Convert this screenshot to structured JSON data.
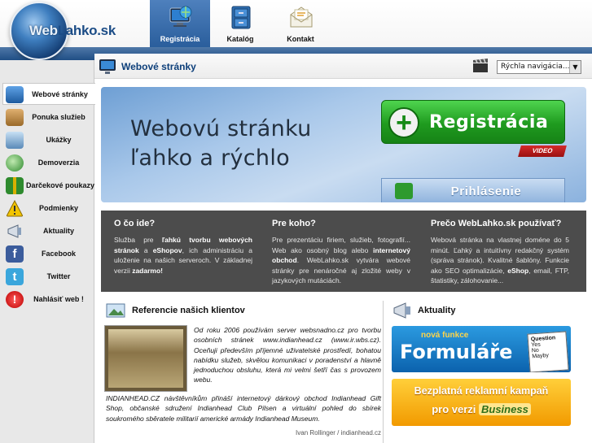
{
  "logo": {
    "part1": "Web",
    "part2": "Lahko.sk"
  },
  "nav": {
    "tabs": [
      {
        "label": "Registrácia",
        "icon": "monitor-globe-icon",
        "active": true
      },
      {
        "label": "Katalóg",
        "icon": "cabinet-icon",
        "active": false
      },
      {
        "label": "Kontakt",
        "icon": "envelope-icon",
        "active": false
      }
    ]
  },
  "sidebar": {
    "items": [
      {
        "label": "Webové stránky",
        "icon": "monitor-icon",
        "active": true
      },
      {
        "label": "Ponuka služieb",
        "icon": "box-icon"
      },
      {
        "label": "Ukážky",
        "icon": "image-icon"
      },
      {
        "label": "Demoverzia",
        "icon": "magnifier-icon"
      },
      {
        "label": "Darčekové poukazy",
        "icon": "gift-icon"
      },
      {
        "label": "Podmienky",
        "icon": "warning-icon"
      },
      {
        "label": "Aktuality",
        "icon": "megaphone-icon"
      },
      {
        "label": "Facebook",
        "icon": "facebook-icon"
      },
      {
        "label": "Twitter",
        "icon": "twitter-icon"
      },
      {
        "label": "Nahlásiť web !",
        "icon": "alert-icon"
      }
    ]
  },
  "page": {
    "title": "Webové stránky",
    "quick_nav": "Rýchla navigácia..."
  },
  "banner": {
    "line1": "Webovú stránku",
    "line2": "ľahko a rýchlo",
    "register_label": "Registrácia",
    "video_label": "VIDEO",
    "login_label": "Prihlásenie"
  },
  "info": {
    "col1": {
      "title": "O čo ide?"
    },
    "col2": {
      "title": "Pre koho?"
    },
    "col3": {
      "title": "Prečo WebLahko.sk používať?"
    }
  },
  "references": {
    "title": "Referencie našich klientov",
    "quote": "Od roku 2006 používám server websnadno.cz pro tvorbu osobních stránek www.indianhead.cz (www.ir.wbs.cz). Oceňuji především příjemné uživatelské prostředí, bohatou nabídku služeb, skvělou komunikaci v poradenství a hlavně jednoduchou obsluhu, která mi velmi šetří čas s provozem webu.",
    "description": "INDIANHEAD.CZ návštěvníkům přináší internetový dárkový obchod Indianhead Gift Shop, občanské sdružení Indianhead Club Pilsen a virtuální pohled do sbírek soukromého sběratele militarií americké armády Indianhead Museum.",
    "author": "Ivan Rollinger / indianhead.cz"
  },
  "news": {
    "title": "Aktuality",
    "promo1_small": "nová funkce",
    "promo1_big": "Formuláře",
    "promo1_card": {
      "q": "Question",
      "a1": "Yes",
      "a2": "No",
      "a3": "Mayby"
    },
    "promo2_line1": "Bezplatná reklamní kampaň",
    "promo2_line2": "pro verzi",
    "promo2_badge": "Business"
  },
  "colors": {
    "brand_blue": "#1f4e85",
    "register_green": "#1f9b1f",
    "info_bg": "#4c4c4c"
  }
}
